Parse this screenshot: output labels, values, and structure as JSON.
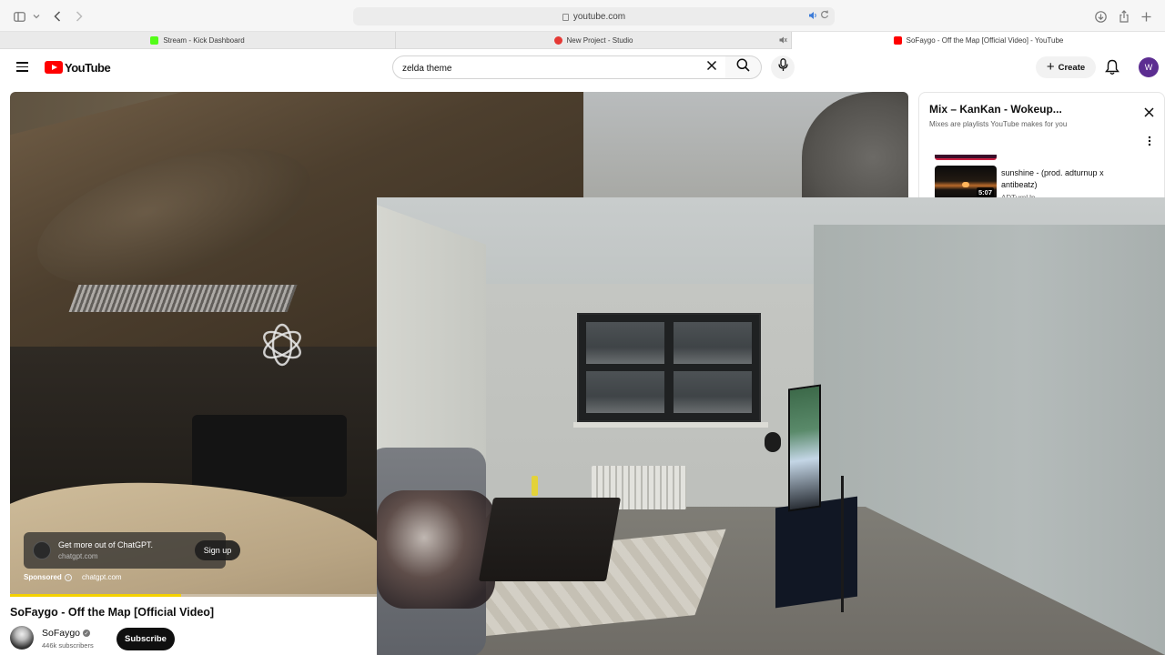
{
  "browser": {
    "url": "youtube.com",
    "tabs": [
      {
        "label": "Stream - Kick Dashboard",
        "favicon_color": "#53fc18"
      },
      {
        "label": "New Project - Studio",
        "favicon_color": "#e53935"
      },
      {
        "label": "SoFaygo - Off the Map [Official Video] - YouTube",
        "favicon_color": "#ff0000"
      }
    ]
  },
  "youtube": {
    "logo_text": "YouTube",
    "search_query": "zelda theme",
    "create_label": "Create",
    "avatar_letter": "W",
    "avatar_color": "#5c2d91"
  },
  "player": {
    "ad": {
      "title": "Get more out of ChatGPT.",
      "domain": "chatgpt.com",
      "cta": "Sign up",
      "sponsored_label": "Sponsored",
      "sponsor_domain": "chatgpt.com"
    },
    "progress_fraction": 0.19,
    "progress_color": "#f4d100"
  },
  "video": {
    "title": "SoFaygo - Off the Map [Official Video]",
    "channel": "SoFaygo",
    "subscribers": "446k subscribers",
    "subscribe_label": "Subscribe"
  },
  "mix": {
    "title": "Mix – KanKan - Wokeup...",
    "subtitle": "Mixes are playlists YouTube makes for you",
    "item": {
      "title": "sunshine - (prod. adturnup x antibeatz)",
      "channel": "ADTurnUp",
      "duration": "5:07"
    }
  },
  "icons": [
    "sidebar-icon",
    "chevron-down-icon",
    "back-icon",
    "forward-icon",
    "lock-icon",
    "audio-icon",
    "reload-icon",
    "download-icon",
    "share-icon",
    "new-tab-icon",
    "menu-icon",
    "clear-icon",
    "search-icon",
    "mic-icon",
    "plus-icon",
    "bell-icon",
    "openai-logo-icon",
    "info-icon",
    "verified-icon",
    "close-icon",
    "more-icon"
  ]
}
